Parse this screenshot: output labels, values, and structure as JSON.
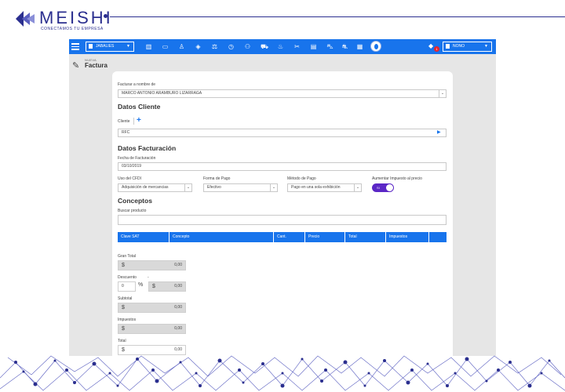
{
  "brand": {
    "name": "MEISHI",
    "tagline": "CONECTAMOS TU EMPRESA",
    "color": "#2b2f8f"
  },
  "app": {
    "accent": "#1874ec",
    "topbar": {
      "branch_select": "JABALIES",
      "user_select": "NONO",
      "notification_badge": "1",
      "icons": [
        "chart-icon",
        "card-icon",
        "user-icon",
        "tag-icon",
        "scale-icon",
        "clock-icon",
        "network-icon",
        "truck-icon",
        "chef-icon",
        "tools-icon",
        "clipboard-icon",
        "cart-icon",
        "car-icon",
        "receipt-icon"
      ]
    },
    "page": {
      "subtitle": "NUEVA",
      "title": "Factura"
    },
    "form": {
      "bill_to_label": "Facturar a nombre de",
      "bill_to_value": "MARCO ANTONIO ARAMBURO LIZARRAGA",
      "client_section_title": "Datos Cliente",
      "client_label": "Cliente",
      "client_value": "RFC",
      "billing_section_title": "Datos Facturación",
      "date_label": "Fecha de Facturación",
      "date_value": "03/10/2019",
      "cfdi_label": "Uso del CFDI",
      "cfdi_value": "Adquisición de mercancias",
      "payment_form_label": "Forma de Pago",
      "payment_form_value": "Efectivo",
      "payment_method_label": "Método de Pago",
      "payment_method_value": "Pago en una sola exhibición",
      "tax_toggle_label": "Aumentar Impuesto al precio",
      "tax_toggle_value": "SI",
      "concepts_title": "Conceptos",
      "search_label": "Buscar producto",
      "search_value": ""
    },
    "table": {
      "columns": [
        "Clave SAT",
        "Concepto",
        "Cant.",
        "Precio",
        "Total",
        "Impuestos",
        ""
      ]
    },
    "totals": {
      "gran_total_label": "Gran Total",
      "gran_total_currency": "$",
      "gran_total_value": "0,00",
      "discount_label": "Descuento",
      "discount_separator": "-",
      "discount_percent": "0",
      "discount_percent_symbol": "%",
      "discount_currency": "$",
      "discount_value": "0,00",
      "subtotal_label": "Subtotal",
      "subtotal_currency": "$",
      "subtotal_value": "0,00",
      "taxes_label": "Impuestos",
      "taxes_currency": "$",
      "taxes_value": "0,00",
      "total_label": "Total",
      "total_currency": "$",
      "total_value": "0,00"
    }
  }
}
